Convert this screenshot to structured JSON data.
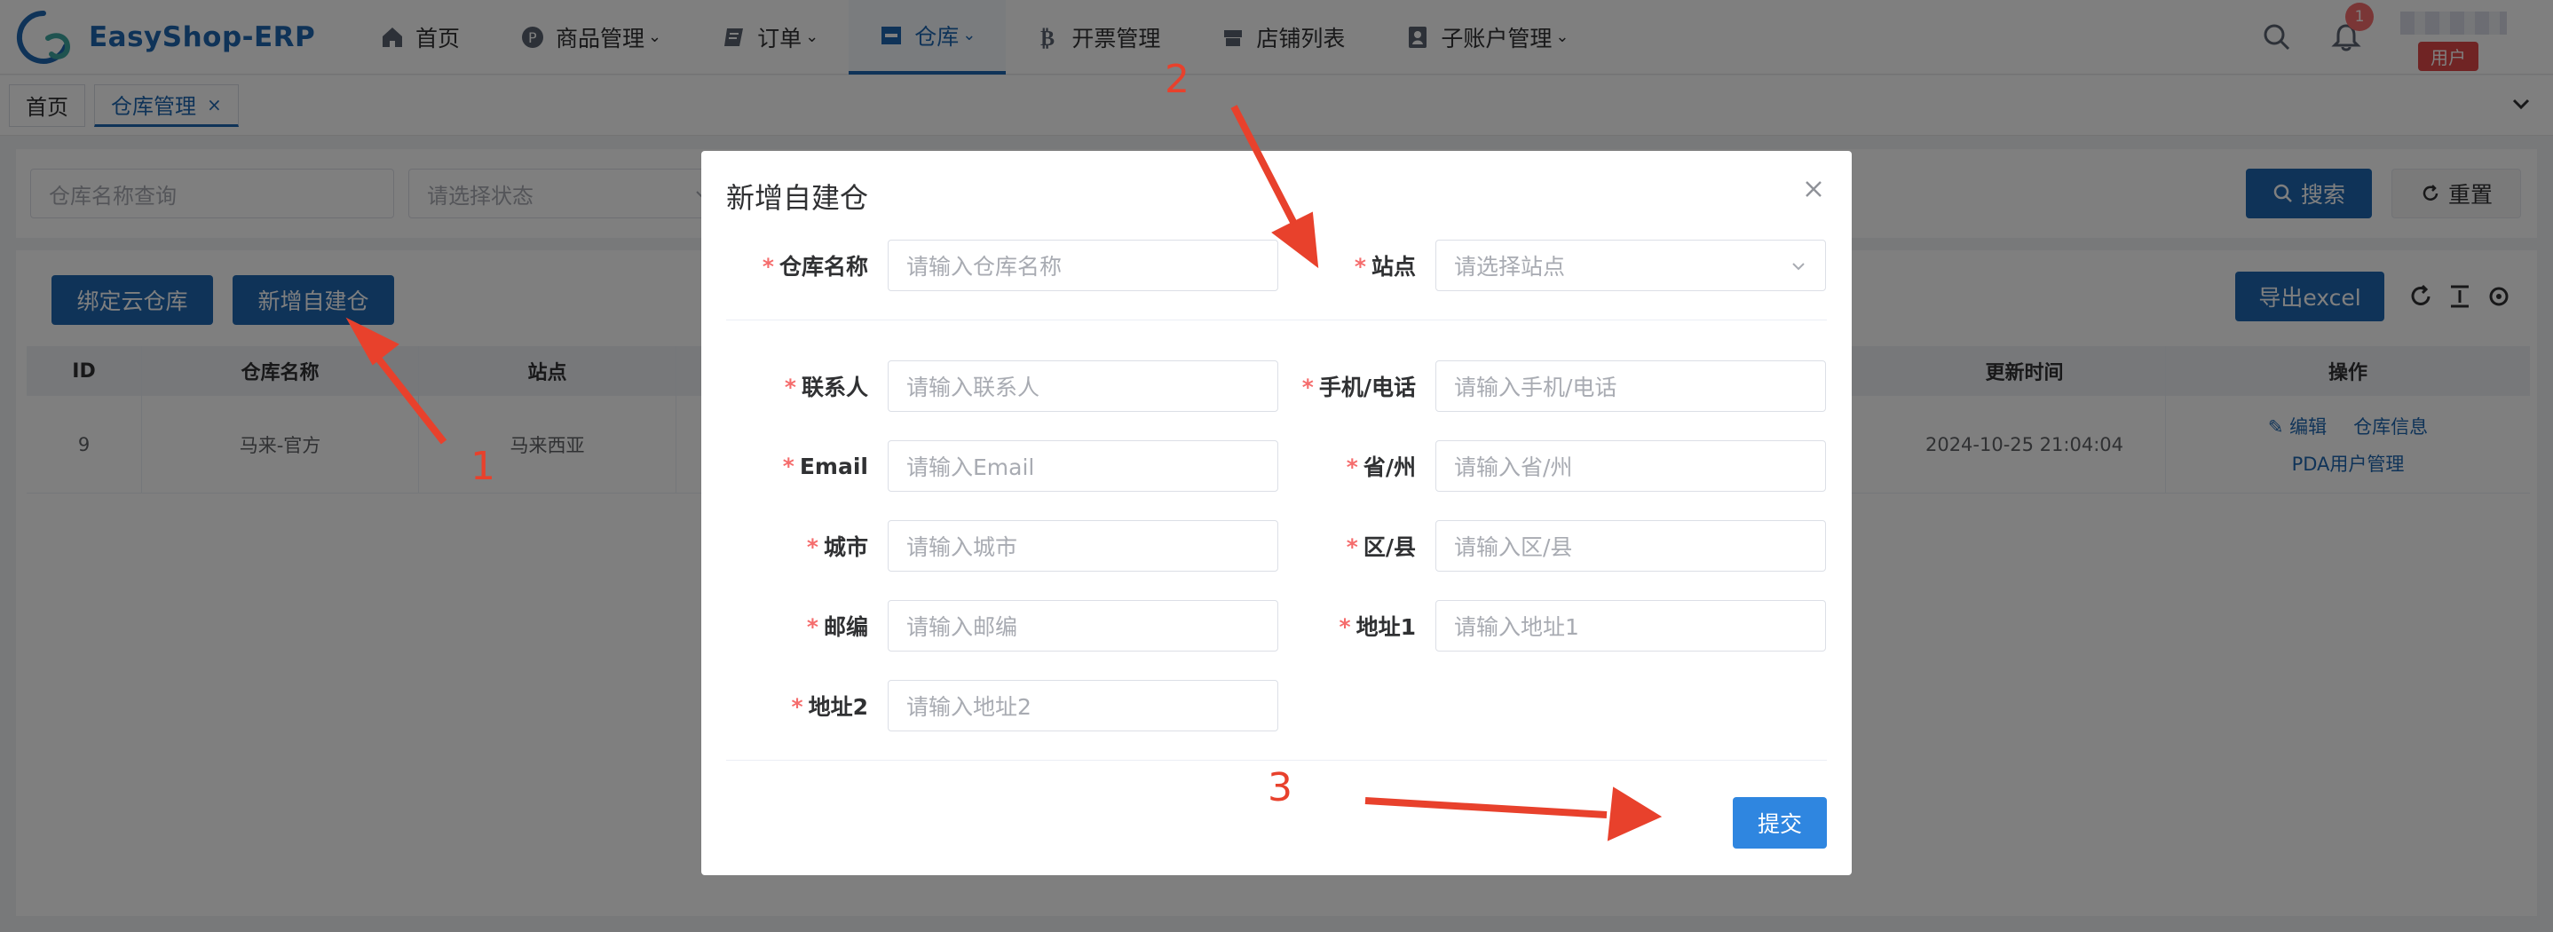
{
  "app": {
    "name": "EasyShop-ERP",
    "colors": {
      "brand": "#1f67b1",
      "danger": "#f56c6c",
      "submit": "#2f86e0",
      "annotation": "#e8412c"
    }
  },
  "nav": [
    {
      "label": "首页",
      "icon": "home-icon",
      "caret": false,
      "active": false
    },
    {
      "label": "商品管理",
      "icon": "product-icon",
      "caret": true,
      "active": false
    },
    {
      "label": "订单",
      "icon": "order-icon",
      "caret": true,
      "active": false
    },
    {
      "label": "仓库",
      "icon": "warehouse-icon",
      "caret": true,
      "active": true
    },
    {
      "label": "开票管理",
      "icon": "bitcoin-icon",
      "caret": false,
      "active": false
    },
    {
      "label": "店铺列表",
      "icon": "store-icon",
      "caret": false,
      "active": false
    },
    {
      "label": "子账户管理",
      "icon": "account-icon",
      "caret": true,
      "active": false
    }
  ],
  "header": {
    "notification_count": "1",
    "user_tag": "用户"
  },
  "tabs": [
    {
      "label": "首页",
      "active": false
    },
    {
      "label": "仓库管理",
      "active": true,
      "close": "×"
    }
  ],
  "filter": {
    "name_placeholder": "仓库名称查询",
    "status_placeholder": "请选择状态",
    "search_label": "搜索",
    "reset_label": "重置"
  },
  "toolbar": {
    "bind_label": "绑定云仓库",
    "add_label": "新增自建仓",
    "export_label": "导出excel"
  },
  "table": {
    "columns": [
      "ID",
      "仓库名称",
      "站点",
      "更新时间",
      "操作"
    ],
    "rows": [
      {
        "id": "9",
        "name": "马来-官方",
        "site": "马来西亚",
        "updated": "2024-10-25 21:04:04",
        "actions": {
          "edit": "编辑",
          "info": "仓库信息",
          "pda": "PDA用户管理"
        }
      }
    ]
  },
  "dialog": {
    "title": "新增自建仓",
    "fields": {
      "warehouse_name": {
        "label": "仓库名称",
        "placeholder": "请输入仓库名称"
      },
      "site": {
        "label": "站点",
        "placeholder": "请选择站点"
      },
      "contact": {
        "label": "联系人",
        "placeholder": "请输入联系人"
      },
      "phone": {
        "label": "手机/电话",
        "placeholder": "请输入手机/电话"
      },
      "email": {
        "label": "Email",
        "placeholder": "请输入Email"
      },
      "province": {
        "label": "省/州",
        "placeholder": "请输入省/州"
      },
      "city": {
        "label": "城市",
        "placeholder": "请输入城市"
      },
      "district": {
        "label": "区/县",
        "placeholder": "请输入区/县"
      },
      "zip": {
        "label": "邮编",
        "placeholder": "请输入邮编"
      },
      "address1": {
        "label": "地址1",
        "placeholder": "请输入地址1"
      },
      "address2": {
        "label": "地址2",
        "placeholder": "请输入地址2"
      }
    },
    "required_mark": "*",
    "submit_label": "提交"
  },
  "annotations": {
    "n1": "1",
    "n2": "2",
    "n3": "3"
  }
}
